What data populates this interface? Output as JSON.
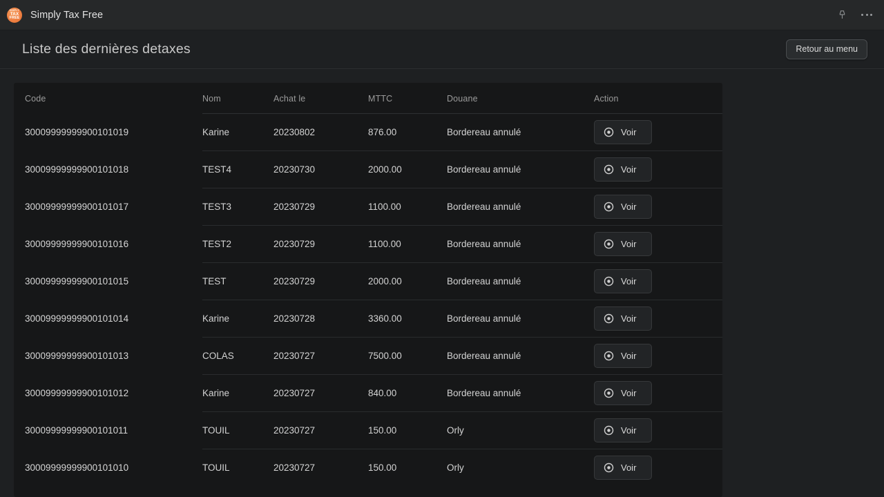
{
  "window": {
    "app_title": "Simply Tax Free",
    "logo": {
      "line1": "SIMPLY",
      "line2": "TAX",
      "line3": "FREE",
      "color": "#ef8043"
    },
    "icons": [
      {
        "name": "pin-icon",
        "glyph": "pin"
      },
      {
        "name": "more-options-icon",
        "glyph": "ellipsis"
      }
    ]
  },
  "header": {
    "title": "Liste des dernières detaxes",
    "back_button": "Retour au menu"
  },
  "table": {
    "columns": [
      "Code",
      "Nom",
      "Achat le",
      "MTTC",
      "Douane",
      "Action"
    ],
    "action_label": "Voir",
    "rows": [
      {
        "code": "30009999999900101019",
        "nom": "Karine",
        "achat_le": "20230802",
        "mttc": "876.00",
        "douane": "Bordereau annulé",
        "action": "Voir"
      },
      {
        "code": "30009999999900101018",
        "nom": "TEST4",
        "achat_le": "20230730",
        "mttc": "2000.00",
        "douane": "Bordereau annulé",
        "action": "Voir"
      },
      {
        "code": "30009999999900101017",
        "nom": "TEST3",
        "achat_le": "20230729",
        "mttc": "1100.00",
        "douane": "Bordereau annulé",
        "action": "Voir"
      },
      {
        "code": "30009999999900101016",
        "nom": "TEST2",
        "achat_le": "20230729",
        "mttc": "1100.00",
        "douane": "Bordereau annulé",
        "action": "Voir"
      },
      {
        "code": "30009999999900101015",
        "nom": "TEST",
        "achat_le": "20230729",
        "mttc": "2000.00",
        "douane": "Bordereau annulé",
        "action": "Voir"
      },
      {
        "code": "30009999999900101014",
        "nom": "Karine",
        "achat_le": "20230728",
        "mttc": "3360.00",
        "douane": "Bordereau annulé",
        "action": "Voir"
      },
      {
        "code": "30009999999900101013",
        "nom": "COLAS",
        "achat_le": "20230727",
        "mttc": "7500.00",
        "douane": "Bordereau annulé",
        "action": "Voir"
      },
      {
        "code": "30009999999900101012",
        "nom": "Karine",
        "achat_le": "20230727",
        "mttc": "840.00",
        "douane": "Bordereau annulé",
        "action": "Voir"
      },
      {
        "code": "30009999999900101011",
        "nom": "TOUIL",
        "achat_le": "20230727",
        "mttc": "150.00",
        "douane": "Orly",
        "action": "Voir"
      },
      {
        "code": "30009999999900101010",
        "nom": "TOUIL",
        "achat_le": "20230727",
        "mttc": "150.00",
        "douane": "Orly",
        "action": "Voir"
      }
    ]
  },
  "colors": {
    "page_background": "#1e2022",
    "titlebar_background": "#262829",
    "card_background": "#161718",
    "accent": "#ef8043",
    "text_primary": "#d6d6d6",
    "text_muted": "#9b9b9b"
  }
}
